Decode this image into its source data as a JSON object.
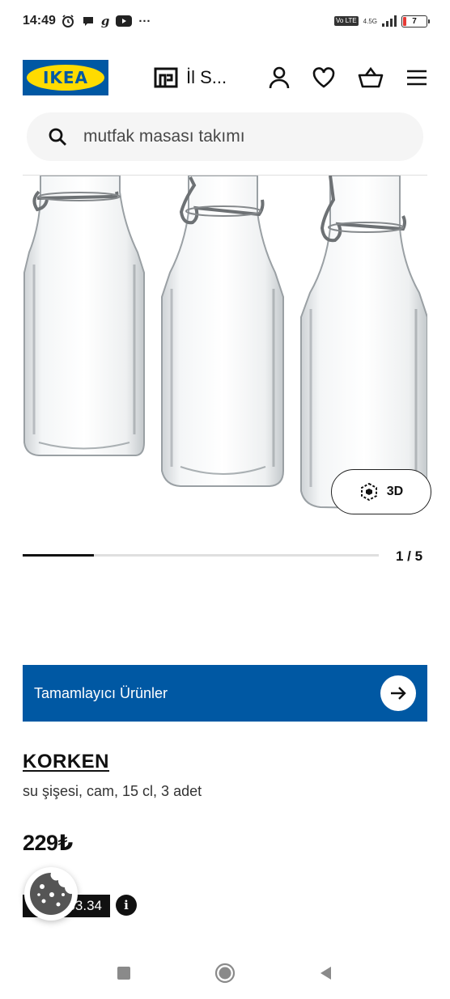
{
  "status_bar": {
    "time": "14:49",
    "more": "···",
    "volte": "Vo LTE",
    "network": "4.5G",
    "battery": "7"
  },
  "header": {
    "logo_text": "IKEA",
    "store_label": "İl S...",
    "icons": [
      "store-icon",
      "user-icon",
      "heart-icon",
      "basket-icon",
      "menu-icon"
    ]
  },
  "search": {
    "placeholder": "mutfak masası takımı",
    "icon": "search-icon"
  },
  "gallery": {
    "three_d_label": "3D",
    "page_indicator": "1 / 5",
    "progress": 0.2
  },
  "banner": {
    "label": "Tamamlayıcı Ürünler",
    "color": "#0058a3"
  },
  "product": {
    "name": "KORKEN",
    "description": "su şişesi, cam, 15 cl, 3 adet",
    "price": "229₺",
    "family_price": "63.34",
    "info_label": "i"
  }
}
